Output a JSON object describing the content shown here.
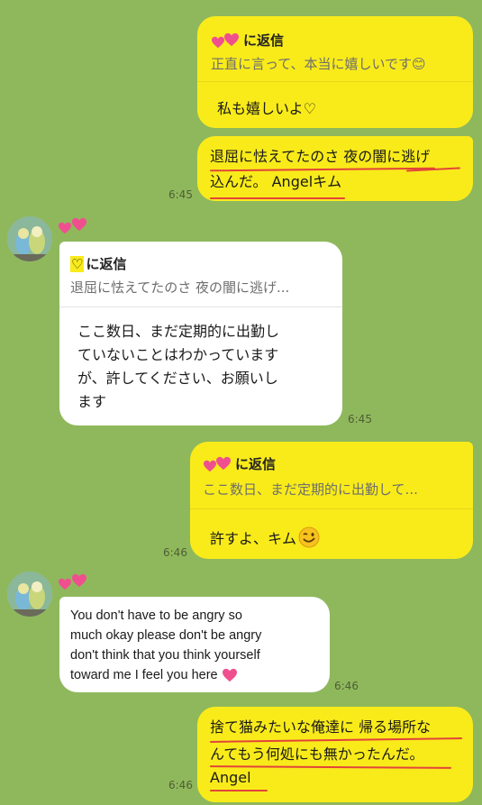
{
  "messages": [
    {
      "reply_to": "に返信",
      "reply_quote": "正直に言って、本当に嬉しいです😊",
      "text": "私も嬉しいよ♡"
    },
    {
      "line1": "退屈に怯えてたのさ 夜の闇に逃げ",
      "line2": "込んだ。 Angelキム",
      "time": "6:45"
    },
    {
      "reply_to": "に返信",
      "reply_prefix": "♡",
      "reply_quote": "退屈に怯えてたのさ 夜の闇に逃げ...",
      "lines": [
        "ここ数日、まだ定期的に出勤し",
        "ていないことはわかっています",
        "が、許してください、お願いし",
        "ます"
      ],
      "time": "6:45"
    },
    {
      "reply_to": "に返信",
      "reply_quote": "ここ数日、まだ定期的に出勤して...",
      "text": "許すよ、キム",
      "time": "6:46"
    },
    {
      "lines": [
        "You don't have to be angry so",
        "much okay please don't be angry",
        "don't think that you think yourself",
        "toward me I feel you here"
      ],
      "time": "6:46"
    },
    {
      "line1": "捨て猫みたいな俺達に 帰る場所な",
      "line2": "んてもう何処にも無かったんだ。",
      "line3": "Angel",
      "time": "6:46"
    }
  ],
  "icons": [
    "two-hearts-icon",
    "smiling-face-icon",
    "winking-face-icon",
    "pink-heart-icon",
    "contact-avatar"
  ],
  "colors": {
    "background": "#8fb85c",
    "outgoing_bubble": "#f9eb1a",
    "incoming_bubble": "#ffffff",
    "underline": "#e2453a",
    "heart": "#f04f8f"
  }
}
